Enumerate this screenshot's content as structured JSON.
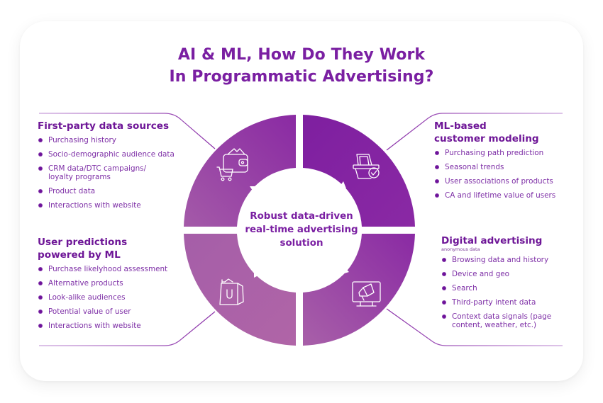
{
  "title": {
    "line1": "AI & ML, How Do They Work",
    "line2": "In Programmatic Advertising?"
  },
  "colors": {
    "accent": "#7a1fa2",
    "ring_dark": "#7e1fa0",
    "ring_light": "#b060a6",
    "connector_line": "#c79bd9"
  },
  "center": {
    "line1": "Robust data-driven",
    "line2": "real-time advertising",
    "line3": "solution"
  },
  "quadrants": [
    {
      "position": "top-left",
      "icon": "wallet-cart-icon",
      "heading_lines": [
        "First-party data sources"
      ],
      "items": [
        "Purchasing history",
        "Socio-demographic audience data",
        "CRM data/DTC campaigns/ loyalty programs",
        "Product data",
        "Interactions with website"
      ]
    },
    {
      "position": "top-right",
      "icon": "basket-check-icon",
      "heading_lines": [
        "ML-based",
        "customer modeling"
      ],
      "items": [
        "Purchasing path prediction",
        "Seasonal trends",
        "User associations of products",
        "CA and lifetime value of users"
      ]
    },
    {
      "position": "bottom-left",
      "icon": "shopping-bag-icon",
      "heading_lines": [
        "User predictions",
        "powered by ML"
      ],
      "items": [
        "Purchase likelyhood assessment",
        "Alternative products",
        "Look-alike audiences",
        "Potential value of user",
        "Interactions with website"
      ]
    },
    {
      "position": "bottom-right",
      "icon": "monitor-megaphone-icon",
      "heading_lines": [
        "Digital advertising"
      ],
      "subheading": "anonymous data",
      "items": [
        "Browsing data and history",
        "Device and geo",
        "Search",
        "Third-party intent data",
        "Context data signals (page content, weather, etc.)"
      ]
    }
  ]
}
